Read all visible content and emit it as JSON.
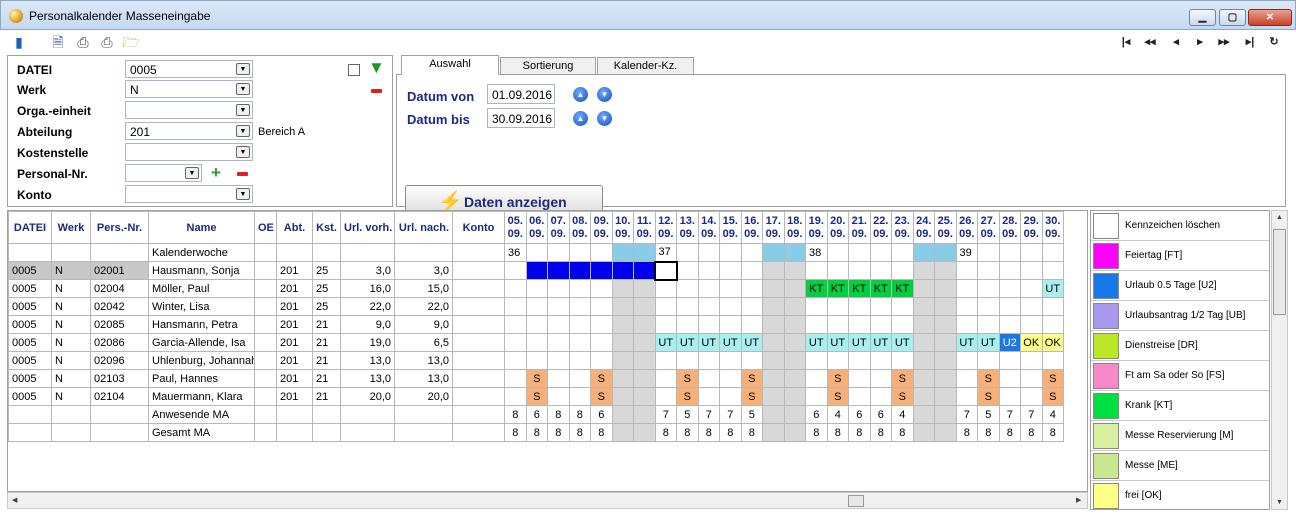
{
  "window": {
    "title": "Personalkalender Masseneingabe"
  },
  "filters": [
    {
      "label": "DATEI",
      "value": "0005",
      "extra": ""
    },
    {
      "label": "Werk",
      "value": "N",
      "extra": ""
    },
    {
      "label": "Orga.-einheit",
      "value": "",
      "extra": ""
    },
    {
      "label": "Abteilung",
      "value": "201",
      "extra": "Bereich A"
    },
    {
      "label": "Kostenstelle",
      "value": "",
      "extra": ""
    },
    {
      "label": "Personal-Nr.",
      "value": "",
      "extra": ""
    },
    {
      "label": "Konto",
      "value": "",
      "extra": ""
    }
  ],
  "tabs": [
    "Auswahl",
    "Sortierung",
    "Kalender-Kz."
  ],
  "dates": {
    "from_label": "Datum von",
    "from_value": "01.09.2016",
    "to_label": "Datum bis",
    "to_value": "30.09.2016"
  },
  "show_button": "Daten anzeigen",
  "columns": [
    "DATEI",
    "Werk",
    "Pers.-Nr.",
    "Name",
    "OE",
    "Abt.",
    "Kst.",
    "Url. vorh.",
    "Url. nach.",
    "Konto"
  ],
  "days": [
    "05.",
    "06.",
    "07.",
    "08.",
    "09.",
    "10.",
    "11.",
    "12.",
    "13.",
    "14.",
    "15.",
    "16.",
    "17.",
    "18.",
    "19.",
    "20.",
    "21.",
    "22.",
    "23.",
    "24.",
    "25.",
    "26.",
    "27.",
    "28.",
    "29.",
    "30."
  ],
  "month": "09.",
  "weekend_indices": [
    5,
    6,
    12,
    13,
    19,
    20
  ],
  "kw_label": "Kalenderwoche",
  "kw": [
    {
      "index": 0,
      "label": "36"
    },
    {
      "index": 7,
      "label": "37"
    },
    {
      "index": 14,
      "label": "38"
    },
    {
      "index": 21,
      "label": "39"
    }
  ],
  "employees": [
    {
      "datei": "0005",
      "werk": "N",
      "nr": "02001",
      "name": "Hausmann, Sonja",
      "oe": "",
      "abt": "201",
      "kst": "25",
      "vorh": "3,0",
      "nach": "3,0",
      "konto": "",
      "cells": {
        "1": "U05",
        "2": "U05",
        "3": "U05",
        "4": "U05",
        "5": "U05",
        "6": "U05",
        "7": "SEL"
      }
    },
    {
      "datei": "0005",
      "werk": "N",
      "nr": "02004",
      "name": "Möller, Paul",
      "oe": "",
      "abt": "201",
      "kst": "25",
      "vorh": "16,0",
      "nach": "15,0",
      "konto": "",
      "cells": {
        "14": "KT",
        "15": "KT",
        "16": "KT",
        "17": "KT",
        "18": "KT",
        "25": "UT"
      }
    },
    {
      "datei": "0005",
      "werk": "N",
      "nr": "02042",
      "name": "Winter, Lisa",
      "oe": "",
      "abt": "201",
      "kst": "25",
      "vorh": "22,0",
      "nach": "22,0",
      "konto": "",
      "cells": {}
    },
    {
      "datei": "0005",
      "werk": "N",
      "nr": "02085",
      "name": "Hansmann, Petra",
      "oe": "",
      "abt": "201",
      "kst": "21",
      "vorh": "9,0",
      "nach": "9,0",
      "konto": "",
      "cells": {}
    },
    {
      "datei": "0005",
      "werk": "N",
      "nr": "02086",
      "name": "Garcia-Allende, Isa",
      "oe": "",
      "abt": "201",
      "kst": "21",
      "vorh": "19,0",
      "nach": "6,5",
      "konto": "",
      "cells": {
        "7": "UT",
        "8": "UT",
        "9": "UT",
        "10": "UT",
        "11": "UT",
        "14": "UT",
        "15": "UT",
        "16": "UT",
        "17": "UT",
        "18": "UT",
        "21": "UT",
        "22": "UT",
        "23": "U2",
        "24": "OK",
        "25": "OK"
      }
    },
    {
      "datei": "0005",
      "werk": "N",
      "nr": "02096",
      "name": "Uhlenburg, Johannah",
      "oe": "",
      "abt": "201",
      "kst": "21",
      "vorh": "13,0",
      "nach": "13,0",
      "konto": "",
      "cells": {}
    },
    {
      "datei": "0005",
      "werk": "N",
      "nr": "02103",
      "name": "Paul, Hannes",
      "oe": "",
      "abt": "201",
      "kst": "21",
      "vorh": "13,0",
      "nach": "13,0",
      "konto": "",
      "cells": {
        "1": "S",
        "4": "S",
        "8": "S",
        "11": "S",
        "15": "S",
        "18": "S",
        "22": "S",
        "25": "S"
      }
    },
    {
      "datei": "0005",
      "werk": "N",
      "nr": "02104",
      "name": "Mauermann, Klara",
      "oe": "",
      "abt": "201",
      "kst": "21",
      "vorh": "20,0",
      "nach": "20,0",
      "konto": "",
      "cells": {
        "1": "S",
        "4": "S",
        "8": "S",
        "11": "S",
        "15": "S",
        "18": "S",
        "22": "S",
        "25": "S"
      }
    }
  ],
  "anwesend": {
    "label": "Anwesende MA",
    "values": [
      "8",
      "6",
      "8",
      "8",
      "6",
      "",
      "",
      "7",
      "5",
      "7",
      "7",
      "5",
      "",
      "",
      "6",
      "4",
      "6",
      "6",
      "4",
      "",
      "",
      "7",
      "5",
      "7",
      "7",
      "4"
    ]
  },
  "gesamt": {
    "label": "Gesamt MA",
    "values": [
      "8",
      "8",
      "8",
      "8",
      "8",
      "",
      "",
      "8",
      "8",
      "8",
      "8",
      "8",
      "",
      "",
      "8",
      "8",
      "8",
      "8",
      "8",
      "",
      "",
      "8",
      "8",
      "8",
      "8",
      "8"
    ]
  },
  "codes": {
    "U05": {
      "text": "",
      "bg": "#0000ee",
      "fg": "#ffffff"
    },
    "SEL": {
      "text": "",
      "bg": "#ffffff",
      "fg": "#000000"
    },
    "KT": {
      "text": "KT",
      "bg": "#00d040",
      "fg": "#000000"
    },
    "UT": {
      "text": "UT",
      "bg": "#a8f0f0",
      "fg": "#000000"
    },
    "U2": {
      "text": "U2",
      "bg": "#1878e8",
      "fg": "#ffffff"
    },
    "OK": {
      "text": "OK",
      "bg": "#ffff88",
      "fg": "#000000"
    },
    "S": {
      "text": "S",
      "bg": "#f8b078",
      "fg": "#000000"
    }
  },
  "legend": [
    {
      "label": "Kennzeichen löschen",
      "color": "#ffffff"
    },
    {
      "label": "Feiertag [FT]",
      "color": "#ff00ff"
    },
    {
      "label": "Urlaub 0.5 Tage [U2]",
      "color": "#1878e8"
    },
    {
      "label": "Urlaubsantrag 1/2 Tag [UB]",
      "color": "#a898f0"
    },
    {
      "label": "Dienstreise [DR]",
      "color": "#b8e828"
    },
    {
      "label": "Ft am Sa oder So [FS]",
      "color": "#f888c8"
    },
    {
      "label": "Krank [KT]",
      "color": "#00e040"
    },
    {
      "label": "Messe Reservierung [M]",
      "color": "#d8f0a0"
    },
    {
      "label": "Messe [ME]",
      "color": "#c8e890"
    },
    {
      "label": "frei [OK]",
      "color": "#ffff88"
    }
  ]
}
